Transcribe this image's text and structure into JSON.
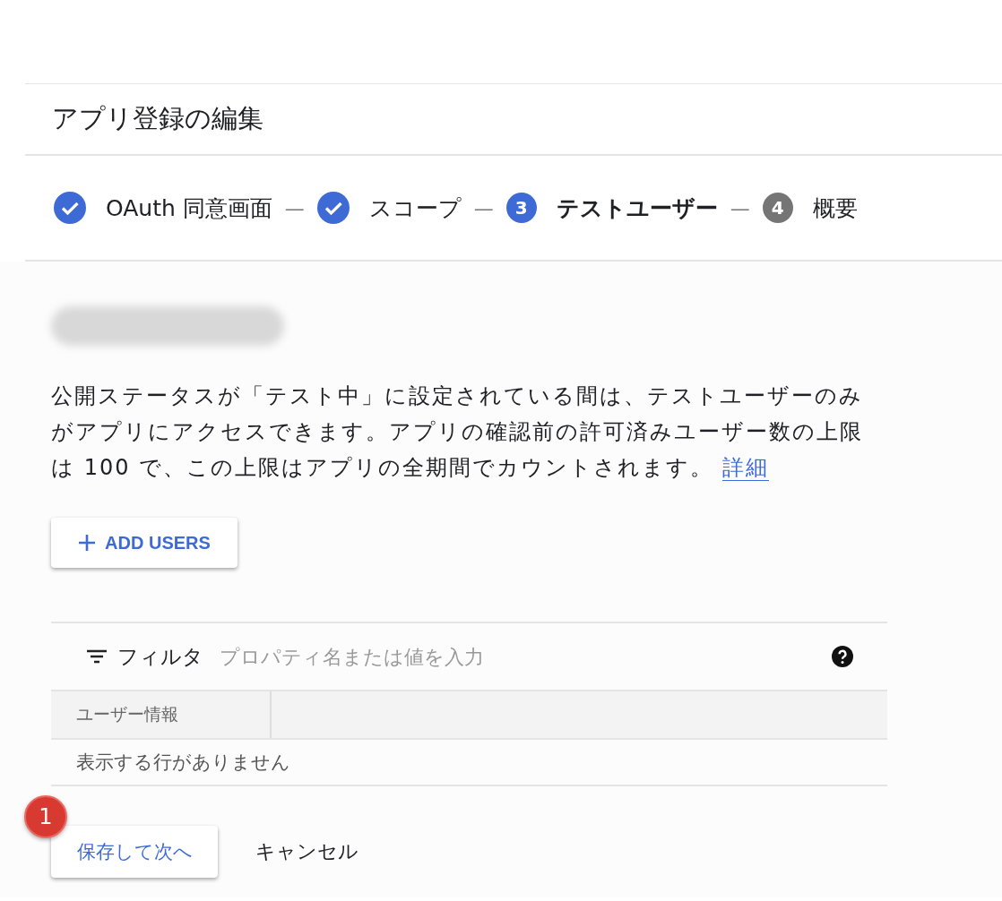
{
  "page_title": "アプリ登録の編集",
  "steps": [
    {
      "label": "OAuth 同意画面",
      "kind": "done"
    },
    {
      "label": "スコープ",
      "kind": "done"
    },
    {
      "label": "テストユーザー",
      "number": "3",
      "kind": "current"
    },
    {
      "label": "概要",
      "number": "4",
      "kind": "pending"
    }
  ],
  "step_separator": "—",
  "description": {
    "text": "公開ステータスが「テスト中」に設定されている間は、テストユーザーのみがアプリにアクセスできます。アプリの確認前の許可済みユーザー数の上限は 100 で、この上限はアプリの全期間でカウントされます。",
    "link": "詳細"
  },
  "add_button": "ADD USERS",
  "filter": {
    "label": "フィルタ",
    "placeholder": "プロパティ名または値を入力"
  },
  "table": {
    "columns": [
      "ユーザー情報"
    ],
    "empty_message": "表示する行がありません"
  },
  "annotation_badge": "1",
  "buttons": {
    "save": "保存して次へ",
    "cancel": "キャンセル"
  }
}
